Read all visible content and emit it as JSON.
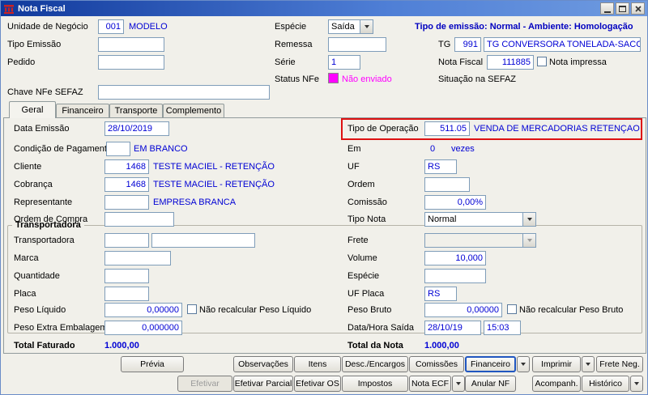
{
  "window": {
    "title": "Nota Fiscal"
  },
  "header": {
    "banner": "Tipo de emissão: Normal - Ambiente: Homologação",
    "unidade": {
      "label": "Unidade de Negócio",
      "code": "001",
      "name": "MODELO"
    },
    "especie": {
      "label": "Espécie",
      "value": "Saída"
    },
    "tipo_emissao": {
      "label": "Tipo Emissão",
      "value": ""
    },
    "remessa": {
      "label": "Remessa",
      "value": ""
    },
    "tg": {
      "label": "TG",
      "code": "991",
      "name": "TG CONVERSORA TONELADA-SACO"
    },
    "pedido": {
      "label": "Pedido",
      "value": ""
    },
    "serie": {
      "label": "Série",
      "value": "1"
    },
    "nota_fiscal": {
      "label": "Nota Fiscal",
      "value": "111885",
      "checkbox_label": "Nota impressa"
    },
    "status_nfe": {
      "label": "Status NFe",
      "value": "Não enviado"
    },
    "situacao_sefaz_label": "Situação na SEFAZ",
    "chave": {
      "label": "Chave NFe SEFAZ",
      "value": ""
    }
  },
  "tabs": [
    {
      "label": "Geral"
    },
    {
      "label": "Financeiro"
    },
    {
      "label": "Transporte"
    },
    {
      "label": "Complemento"
    }
  ],
  "geral": {
    "data_emissao": {
      "label": "Data Emissão",
      "value": "28/10/2019"
    },
    "tipo_operacao": {
      "label": "Tipo de Operação",
      "code": "511.05",
      "name": "VENDA DE MERCADORIAS RETENÇAO"
    },
    "condicao": {
      "label": "Condição de Pagamento",
      "value": "",
      "name": "EM BRANCO"
    },
    "em": {
      "label": "Em",
      "value": "0",
      "suffix": "vezes"
    },
    "cliente": {
      "label": "Cliente",
      "code": "1468",
      "name": "TESTE MACIEL - RETENÇÃO"
    },
    "uf": {
      "label": "UF",
      "value": "RS"
    },
    "cobranca": {
      "label": "Cobrança",
      "code": "1468",
      "name": "TESTE MACIEL - RETENÇÃO"
    },
    "ordem": {
      "label": "Ordem",
      "value": ""
    },
    "representante": {
      "label": "Representante",
      "code": "",
      "name": "EMPRESA BRANCA"
    },
    "comissao": {
      "label": "Comissão",
      "value": "0,00%"
    },
    "ordem_compra": {
      "label": "Ordem de Compra",
      "value": ""
    },
    "tipo_nota": {
      "label": "Tipo Nota",
      "value": "Normal"
    }
  },
  "transportadora": {
    "title": "Transportadora",
    "transportadora": {
      "label": "Transportadora",
      "code": "",
      "name": ""
    },
    "frete": {
      "label": "Frete",
      "value": ""
    },
    "marca": {
      "label": "Marca",
      "value": ""
    },
    "volume": {
      "label": "Volume",
      "value": "10,000"
    },
    "quantidade": {
      "label": "Quantidade",
      "value": ""
    },
    "especie": {
      "label": "Espécie",
      "value": ""
    },
    "placa": {
      "label": "Placa",
      "value": ""
    },
    "uf_placa": {
      "label": "UF Placa",
      "value": "RS"
    },
    "peso_liquido": {
      "label": "Peso Líquido",
      "value": "0,00000",
      "check_label": "Não recalcular Peso Líquido"
    },
    "peso_bruto": {
      "label": "Peso Bruto",
      "value": "0,00000",
      "check_label": "Não recalcular Peso Bruto"
    },
    "peso_extra": {
      "label": "Peso Extra Embalagem",
      "value": "0,000000"
    },
    "data_saida": {
      "label": "Data/Hora Saída",
      "date": "28/10/19",
      "time": "15:03"
    }
  },
  "totals": {
    "faturado_label": "Total Faturado",
    "faturado_value": "1.000,00",
    "nota_label": "Total da Nota",
    "nota_value": "1.000,00"
  },
  "buttons": {
    "previa": "Prévia",
    "observacoes": "Observações",
    "itens": "Itens",
    "desc_encargos": "Desc./Encargos",
    "comissoes": "Comissões",
    "financeiro": "Financeiro",
    "imprimir": "Imprimir",
    "frete_neg": "Frete Neg.",
    "efetivar": "Efetivar",
    "efetivar_parcial": "Efetivar Parcial",
    "efetivar_os": "Efetivar OS",
    "impostos": "Impostos",
    "nota_ecf": "Nota ECF",
    "anular_nf": "Anular NF",
    "acompanh": "Acompanh.",
    "historico": "Histórico"
  },
  "colors": {
    "value_blue": "#0000d4",
    "banner_blue": "#0000c0",
    "status_magenta": "#ff00ff",
    "highlight_red": "#dd1111",
    "focus_blue": "#2056c0"
  }
}
